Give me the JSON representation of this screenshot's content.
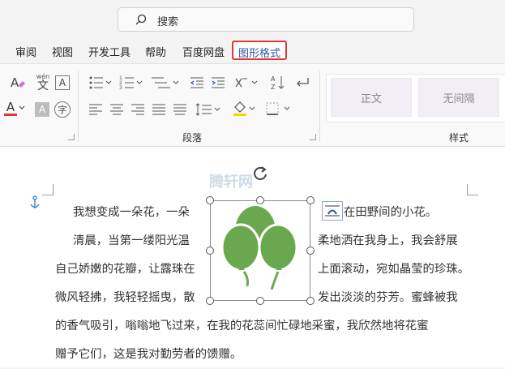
{
  "search": {
    "placeholder_label": "搜索"
  },
  "tabs": [
    {
      "label": "审阅"
    },
    {
      "label": "视图"
    },
    {
      "label": "开发工具"
    },
    {
      "label": "帮助"
    },
    {
      "label": "百度网盘"
    },
    {
      "label": "图形格式"
    }
  ],
  "ribbon": {
    "paragraph_group_label": "段落",
    "styles_group_label": "样式",
    "styles": [
      {
        "label": "正文"
      },
      {
        "label": "无间隔"
      }
    ],
    "font_color_letter": "A",
    "phonetic_label": "wén",
    "phonetic_char": "文",
    "enclose_char": "字",
    "font_color_hex": "#e0373a"
  },
  "document": {
    "watermark": "腾轩网",
    "lines": [
      {
        "left": "我想变成一朵花，一朵",
        "right": "在田野间的小花。"
      },
      {
        "left": "清晨，当第一缕阳光温",
        "right": "柔地洒在我身上，我会舒展"
      },
      {
        "left": "自己娇嫩的花瓣，让露珠在",
        "right": "上面滚动，宛如晶莹的珍珠。"
      },
      {
        "left": "微风轻拂，我轻轻摇曳，散",
        "right": "发出淡淡的芬芳。蜜蜂被我"
      },
      {
        "full": "的香气吸引，嗡嗡地飞过来，在我的花蕊间忙碌地采蜜，我欣然地将花蜜"
      },
      {
        "full": "赠予它们，这是我对勤劳者的馈赠。"
      }
    ],
    "balloon_color": "#6aa84f"
  }
}
